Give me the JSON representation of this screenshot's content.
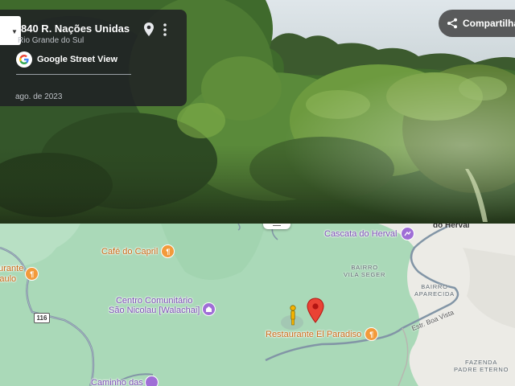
{
  "street_view": {
    "address_title": "840 R. Nações Unidas",
    "address_subtitle": "Rio Grande do Sul",
    "brand_label": "Google Street View",
    "capture_date": "ago. de 2023",
    "share_label": "Compartilhar"
  },
  "map": {
    "places": [
      {
        "name": "Cascata do Herval",
        "kind": "attraction"
      },
      {
        "name": "Café do Capril",
        "kind": "restaurant"
      },
      {
        "name": "Centro Comunitário\nSão Nicolau [Walachai]",
        "kind": "community"
      },
      {
        "name": "Restaurante El Paradiso",
        "kind": "restaurant"
      },
      {
        "name": "aurante\nPaulo",
        "kind": "restaurant"
      },
      {
        "name": "Caminho das",
        "kind": "attraction"
      }
    ],
    "area_labels": [
      "BAIRRO\nVILA SEGER",
      "BAIRRO\nAPARECIDA",
      "FAZENDA\nPADRE ETERNO"
    ],
    "town_label": "do Herval",
    "road_label": "Estr. Boa Vista",
    "route_shield": "116",
    "colors": {
      "terrain": "#aad9b8",
      "urban": "#ecebe6",
      "road": "#7a8ea0",
      "pin": "#ea4335",
      "poi_orange": "#f29a3b",
      "poi_purple": "#9f6ed6"
    }
  }
}
